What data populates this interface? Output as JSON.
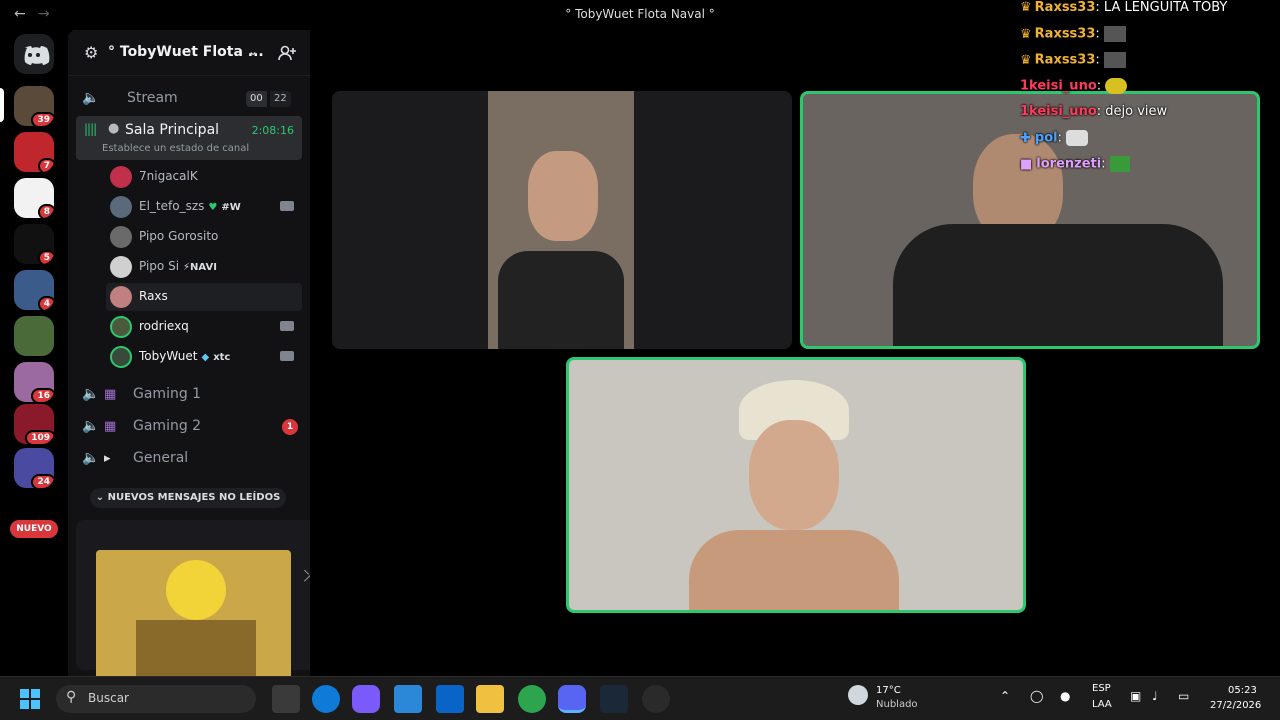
{
  "window": {
    "title": "° TobyWuet Flota Naval °"
  },
  "rail": {
    "badges": [
      "39",
      "7",
      "8",
      "5",
      "4",
      "16",
      "109",
      "24"
    ],
    "nuevo_label": "NUEVO"
  },
  "guild": {
    "name": "° TobyWuet Flota ..."
  },
  "channels": {
    "stream": {
      "label": "Stream",
      "count_a": "00",
      "count_b": "22"
    },
    "sala": {
      "label": "Sala Principal",
      "timer": "2:08:16",
      "status": "Establece un estado de canal"
    },
    "gaming1": {
      "label": "Gaming 1"
    },
    "gaming2": {
      "label": "Gaming 2",
      "badge": "1"
    },
    "general": {
      "label": "General"
    }
  },
  "users": [
    {
      "name": "7nigacalK",
      "tag": ""
    },
    {
      "name": "El_tefo_szs",
      "tag": "#W"
    },
    {
      "name": "Pipo Gorosito",
      "tag": ""
    },
    {
      "name": "Pipo Si",
      "tag": "⚡NAVI"
    },
    {
      "name": "Raxs",
      "tag": ""
    },
    {
      "name": "rodriexq",
      "tag": ""
    },
    {
      "name": "TobyWuet",
      "tag": "xtc"
    }
  ],
  "new_messages_label": "NUEVOS MENSAJES NO LEÍDOS",
  "chat": [
    {
      "name": "Raxss33",
      "msg": "LA LENGUITA TOBY",
      "color": "#f0b232"
    },
    {
      "name": "Raxss33",
      "msg": "",
      "color": "#f0b232"
    },
    {
      "name": "Raxss33",
      "msg": "",
      "color": "#f0b232"
    },
    {
      "name": "1keisi_uno",
      "msg": "",
      "color": "#ff3b5c"
    },
    {
      "name": "1keisi_uno",
      "msg": "dejo view",
      "color": "#ff3b5c"
    },
    {
      "name": "pol",
      "msg": "",
      "color": "#4aa3ff"
    },
    {
      "name": "lorenzeti",
      "msg": "",
      "color": "#e0a0ff"
    }
  ],
  "taskbar": {
    "search_label": "Buscar",
    "weather_temp": "17°C",
    "weather_desc": "Nublado",
    "lang_top": "ESP",
    "lang_bottom": "LAA",
    "time": "05:23",
    "date": "27/2/2026"
  },
  "colors": {
    "speaking": "#2dc770",
    "badge": "#da373c",
    "sidebar": "#121214"
  }
}
